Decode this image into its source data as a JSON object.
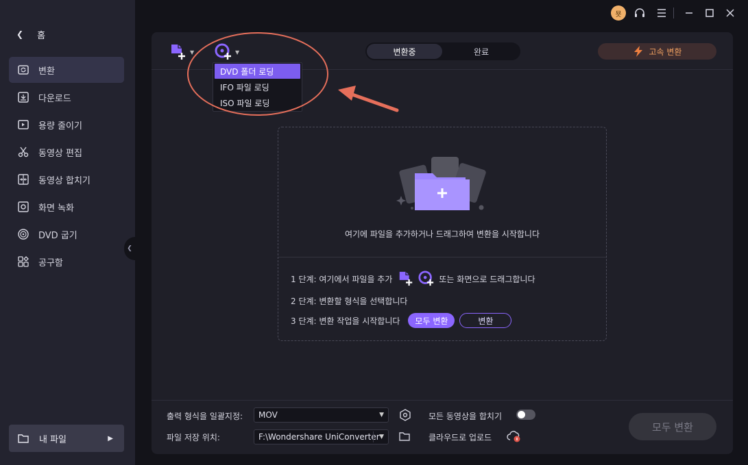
{
  "sidebar": {
    "home_label": "홈",
    "items": [
      {
        "label": "변환",
        "icon": "convert-icon",
        "active": true
      },
      {
        "label": "다운로드",
        "icon": "download-icon"
      },
      {
        "label": "용량 줄이기",
        "icon": "compress-icon"
      },
      {
        "label": "동영상 편집",
        "icon": "scissors-icon"
      },
      {
        "label": "동영상 합치기",
        "icon": "merge-icon"
      },
      {
        "label": "화면 녹화",
        "icon": "record-icon"
      },
      {
        "label": "DVD 굽기",
        "icon": "disc-icon"
      },
      {
        "label": "공구함",
        "icon": "toolbox-icon"
      }
    ],
    "my_files_label": "내 파일"
  },
  "titlebar": {
    "avatar_text": "묫"
  },
  "toolbar": {
    "tabs": [
      {
        "label": "변환중",
        "active": true
      },
      {
        "label": "완료",
        "active": false
      }
    ],
    "turbo_label": "고속 변환"
  },
  "dvd_menu": {
    "items": [
      {
        "label": "DVD 폴더 로딩",
        "selected": true
      },
      {
        "label": "IFO 파일 로딩"
      },
      {
        "label": "ISO 파일 로딩"
      }
    ]
  },
  "dropzone": {
    "hint": "여기에 파일을 추가하거나 드래그하여 변환을 시작합니다",
    "step1_prefix": "1 단계: 여기에서 파일을 추가",
    "step1_suffix": "또는 화면으로 드래그합니다",
    "step2": "2 단계: 변환할 형식을 선택합니다",
    "step3": "3 단계: 변환 작업을 시작합니다",
    "convert_all_btn": "모두 변환",
    "convert_btn": "변환"
  },
  "bottom": {
    "output_format_label": "출력 형식을 일괄지정:",
    "output_format_value": "MOV",
    "merge_label": "모든 동영상을 합치기",
    "save_location_label": "파일 저장 위치:",
    "save_location_value": "F:\\Wondershare UniConverter",
    "cloud_upload_label": "클라우드로 업로드",
    "convert_all_label": "모두 변환"
  },
  "colors": {
    "accent": "#8b66ff",
    "annotation": "#e66f5b",
    "turbo": "#f0a060"
  }
}
